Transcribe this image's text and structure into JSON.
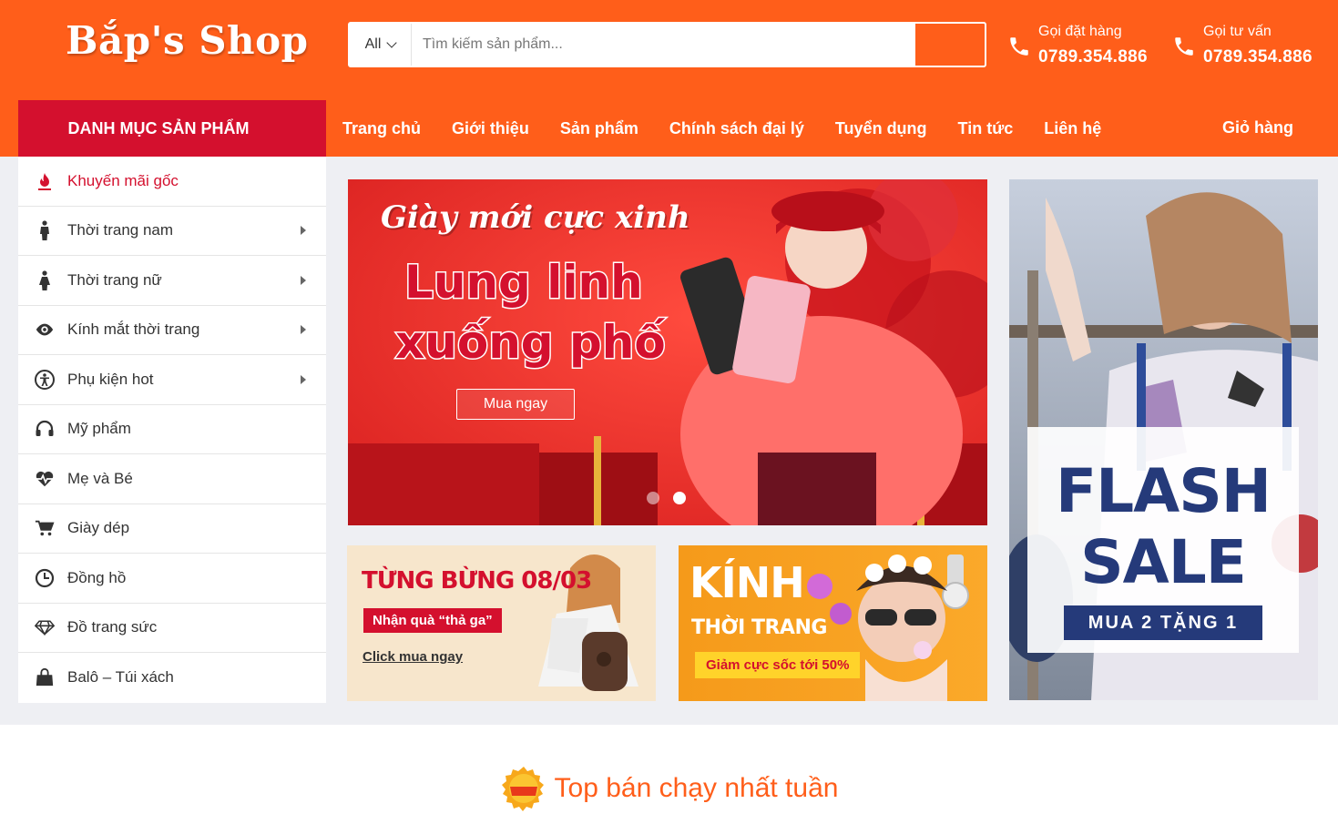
{
  "header": {
    "logo": "Bắp's Shop",
    "search": {
      "category": "All",
      "placeholder": "Tìm kiếm sản phẩm..."
    },
    "hotlines": [
      {
        "label": "Gọi đặt hàng",
        "number": "0789.354.886"
      },
      {
        "label": "Gọi tư vấn",
        "number": "0789.354.886"
      }
    ]
  },
  "nav": {
    "category_title": "DANH MỤC SẢN PHẨM",
    "links": [
      "Trang chủ",
      "Giới thiệu",
      "Sản phẩm",
      "Chính sách đại lý",
      "Tuyển dụng",
      "Tin tức",
      "Liên hệ"
    ],
    "cart": "Giỏ hàng"
  },
  "sidebar": {
    "items": [
      {
        "label": "Khuyến mãi gốc",
        "icon": "fire-icon"
      },
      {
        "label": "Thời trang nam",
        "icon": "male-icon"
      },
      {
        "label": "Thời trang nữ",
        "icon": "female-icon"
      },
      {
        "label": "Kính mắt thời trang",
        "icon": "eye-icon"
      },
      {
        "label": "Phụ kiện hot",
        "icon": "accessibility-icon"
      },
      {
        "label": "Mỹ phẩm",
        "icon": "headphones-icon"
      },
      {
        "label": "Mẹ và Bé",
        "icon": "heartbeat-icon"
      },
      {
        "label": "Giày dép",
        "icon": "cart-plus-icon"
      },
      {
        "label": "Đồng hồ",
        "icon": "clock-icon"
      },
      {
        "label": "Đồ trang sức",
        "icon": "diamond-icon"
      },
      {
        "label": "Balô – Túi xách",
        "icon": "shopping-bag-icon"
      }
    ]
  },
  "banners": {
    "main": {
      "line1": "Giày mới cực xinh",
      "line2": "Lung linh",
      "line3": "xuống phố",
      "button": "Mua ngay"
    },
    "promo_a": {
      "title": "TỪNG BỪNG 08/03",
      "tag": "Nhận quà “thả ga”",
      "link": "Click mua ngay"
    },
    "promo_b": {
      "title1": "KÍNH",
      "title2": "THỜI TRANG",
      "tag": "Giảm cực sốc tới 50%"
    },
    "flash": {
      "line1": "FLASH",
      "line2": "SALE",
      "sub": "MUA 2 TẶNG 1"
    }
  },
  "section": {
    "title": "Top bán chạy nhất tuần"
  },
  "colors": {
    "primary": "#ff5e1a",
    "category_red": "#d4102e",
    "flash_navy": "#253a7a"
  }
}
